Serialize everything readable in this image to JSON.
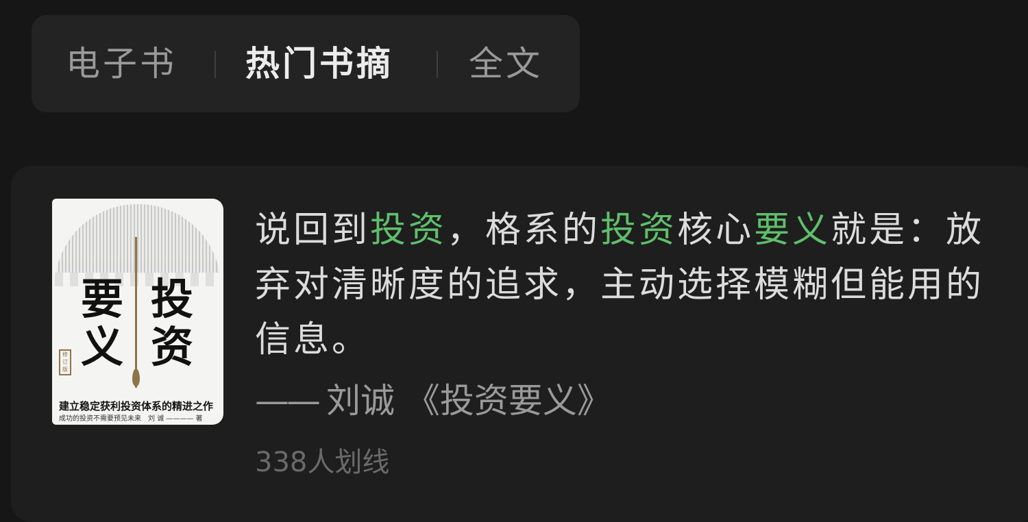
{
  "tabs": {
    "ebook": "电子书",
    "excerpts": "热门书摘",
    "fulltext": "全文"
  },
  "book": {
    "cover_title_left": "要义",
    "cover_title_right": "投资",
    "cover_edition": "修订版",
    "cover_tagline": "建立稳定获利投资体系的精进之作",
    "cover_sub": "成功的投资不需要预见未来",
    "cover_author": "刘 诚 ———— 著"
  },
  "quote": {
    "seg1": "说回到",
    "hl1": "投资",
    "seg2": "，格系的",
    "hl2": "投资",
    "seg3": "核心",
    "hl3": "要义",
    "seg4": "就是：放弃对清晰度的追求，主动选择模糊但能用的信息。",
    "dash": "——",
    "author": "刘诚",
    "title": "《投资要义》",
    "underline_count": "338人划线"
  },
  "colors": {
    "background": "#161616",
    "card": "#1e1e1e",
    "highlight": "#5fbf6b",
    "text": "#dcdcdc"
  }
}
